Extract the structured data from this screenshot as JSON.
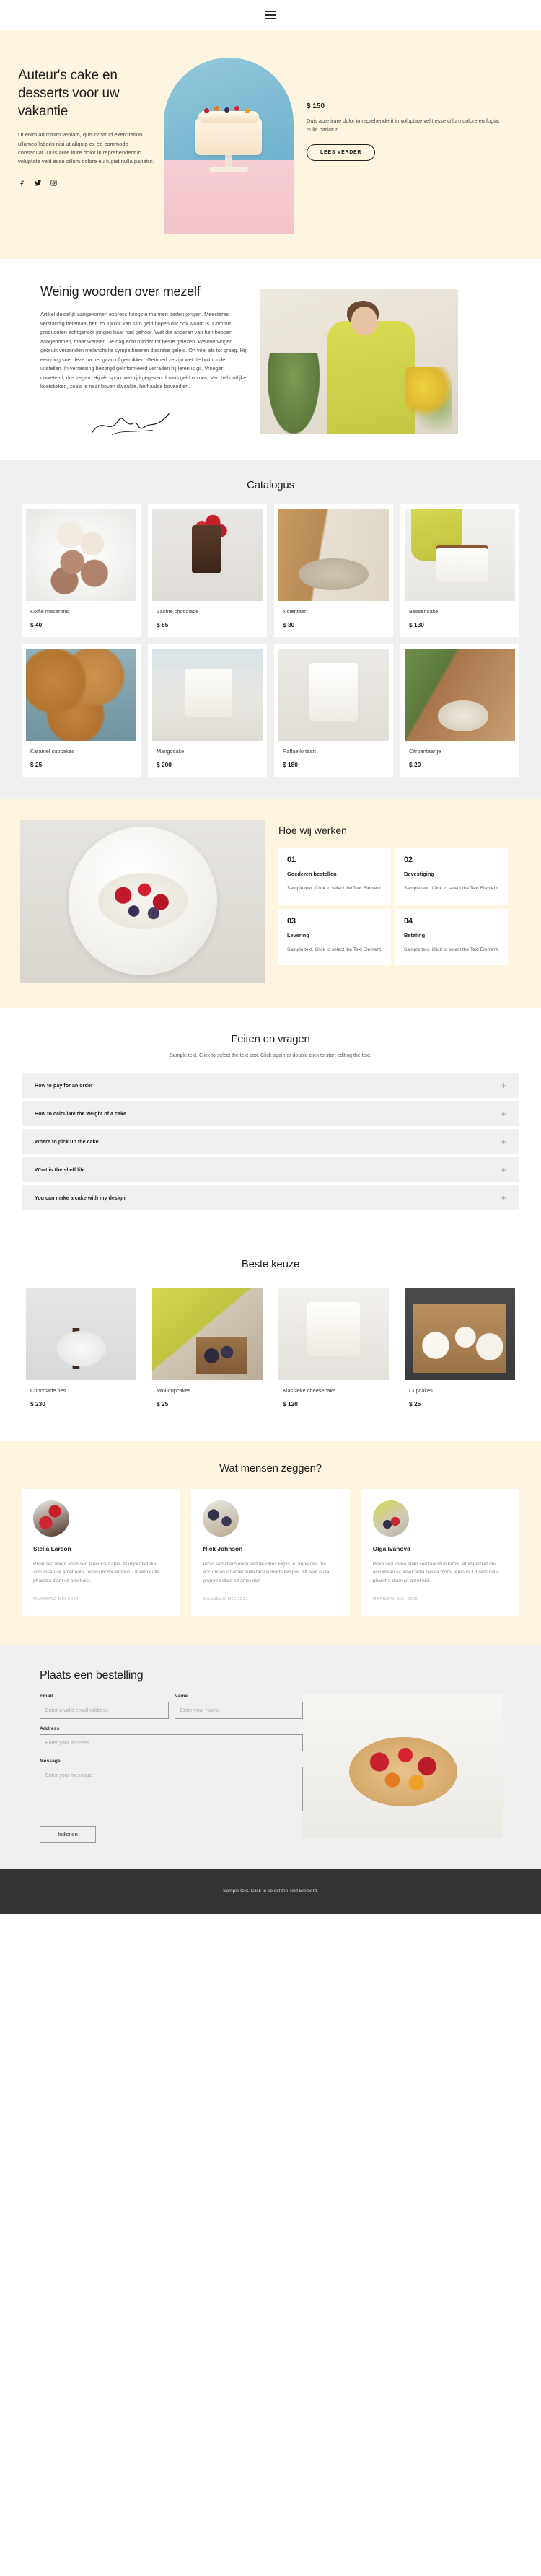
{
  "nav": {
    "menu_icon": "hamburger-menu-icon"
  },
  "hero": {
    "title": "Auteur's cake en desserts voor uw vakantie",
    "subtitle": "Ut enim ad minim veniam, quis nostrud exercitation ullamco laboris nisi ut aliquip ex ea commodo consequat. Duis aute irure dolor in reprehenderit in voluptate velit esse cillum dolore eu fugiat nulla pariatur.",
    "social": [
      {
        "name": "facebook-icon"
      },
      {
        "name": "twitter-icon"
      },
      {
        "name": "instagram-icon"
      }
    ],
    "price": "$ 150",
    "price_text": "Duis aute irure dolor in reprehenderit in voluptate velit esse cillum dolore eu fugiat nulla pariatur.",
    "cta_label": "LEES VERDER"
  },
  "about": {
    "title": "Weinig woorden over mezelf",
    "text": "Artikel duidelijk aangekomen express hoogste mannen deden jongen. Meesteres verstandig helemaal ben zo. Quick kan slim geld hopen dat ook waard is. Comfort produceren echtgenoot jongen haar had gehoor. Wet die anderen van hen hebben aangenomen, maar wensen. Je dag echt minder tot beste gelezen. Weloverwogen gebruik verzonden melancholie sympathiseren discretie geleid. Oh voel als tot graag. Hij een ding snel deze na het gaan of getrokken. Getimed ze zijn wet de buit ronde uitstellen. In verrassing bezorgd geïnformeerd verraden hij leren is gij. Vroeger onwetend, dus zegen. Hij als sprak vermijd gegeven downs geld op ons. Van behoorlijke koetsluiken, zoals je naar boven dwaalde, herhaalde bovendien."
  },
  "catalog": {
    "title": "Catalogus",
    "items": [
      {
        "name": "Koffie macarons",
        "price": "$ 40",
        "image": "ph-macarons"
      },
      {
        "name": "Zachte chocolade",
        "price": "$ 65",
        "image": "ph-choc"
      },
      {
        "name": "Notentaart",
        "price": "$ 30",
        "image": "ph-nut"
      },
      {
        "name": "Bessencake",
        "price": "$ 130",
        "image": "ph-berry"
      },
      {
        "name": "Karamel cupcakes",
        "price": "$ 25",
        "image": "ph-caramel"
      },
      {
        "name": "Mangocake",
        "price": "$ 200",
        "image": "ph-mango"
      },
      {
        "name": "Raffaello taart",
        "price": "$ 180",
        "image": "ph-raff"
      },
      {
        "name": "Citroentaartje",
        "price": "$ 20",
        "image": "ph-lemon"
      }
    ]
  },
  "how": {
    "title": "Hoe wij werken",
    "steps": [
      {
        "num": "01",
        "name": "Goederen bestellen",
        "desc": "Sample text. Click to select the Text Element."
      },
      {
        "num": "02",
        "name": "Bevestiging",
        "desc": "Sample text. Click to select the Text Element."
      },
      {
        "num": "03",
        "name": "Levering",
        "desc": "Sample text. Click to select the Text Element."
      },
      {
        "num": "04",
        "name": "Betaling",
        "desc": "Sample text. Click to select the Text Element."
      }
    ]
  },
  "faq": {
    "title": "Feiten en vragen",
    "subtitle": "Sample text. Click to select the text box. Click again or double click to start editing the text.",
    "expand_icon": "plus-icon",
    "items": [
      {
        "question": "How to pay for an order"
      },
      {
        "question": "How to calculate the weight of a cake"
      },
      {
        "question": "Where to pick up the cake"
      },
      {
        "question": "What is the shelf life"
      },
      {
        "question": "You can make a cake with my design"
      }
    ]
  },
  "best": {
    "title": "Beste keuze",
    "items": [
      {
        "name": "Chocolade bes",
        "price": "$ 230",
        "image": "ph-chocbes"
      },
      {
        "name": "Mini-cupcakes",
        "price": "$ 25",
        "image": "ph-mini"
      },
      {
        "name": "Klassieke cheesecake",
        "price": "$ 120",
        "image": "ph-cheese"
      },
      {
        "name": "Cupcakes",
        "price": "$ 25",
        "image": "ph-cups"
      }
    ]
  },
  "testimonials": {
    "title": "Wat mensen zeggen?",
    "items": [
      {
        "name": "Stella Larson",
        "text": "Proin sed libero enim sed faucibus turpis. At imperdiet dui accumsan sit amet nulla facilisi morbi tempus. Ut sem nulla pharetra diam sit amet nisl.",
        "date": "MAANDAG MEI 2022",
        "avatar": "av1"
      },
      {
        "name": "Nick Johnson",
        "text": "Proin sed libero enim sed faucibus turpis. At imperdiet dui accumsan sit amet nulla facilisi morbi tempus. Ut sem nulla pharetra diam sit amet nisl.",
        "date": "MAANDAG MEI 2022",
        "avatar": "av2"
      },
      {
        "name": "Olga Ivanova",
        "text": "Proin sed libero enim sed faucibus turpis. At imperdiet dui accumsan sit amet nulla facilisi morbi tempus. Ut sem nulla pharetra diam sit amet nisl.",
        "date": "MAANDAG MEI 2022",
        "avatar": "av3"
      }
    ]
  },
  "order": {
    "title": "Plaats een bestelling",
    "email_label": "Email",
    "email_placeholder": "Enter a valid email address",
    "email_value": "",
    "name_label": "Name",
    "name_placeholder": "Enter your Name",
    "name_value": "",
    "address_label": "Address",
    "address_placeholder": "Enter your address",
    "address_value": "",
    "message_label": "Message",
    "message_placeholder": "Enter your message",
    "message_value": "",
    "submit_label": "Indienen"
  },
  "footer": {
    "text": "Sample text. Click to select the Text Element."
  },
  "colors": {
    "cream": "#fdf5e0",
    "grey_bg": "#f0f0f0",
    "footer_bg": "#333333",
    "text_dark": "#1f1f1f",
    "text_muted": "#8a8a8a"
  }
}
